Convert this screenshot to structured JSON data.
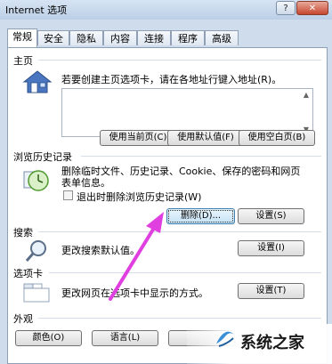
{
  "window": {
    "title": "Internet 选项",
    "help_label": "?",
    "close_label": "✕"
  },
  "tabs": [
    "常规",
    "安全",
    "隐私",
    "内容",
    "连接",
    "程序",
    "高级"
  ],
  "home": {
    "section": "主页",
    "description": "若要创建主页选项卡，请在各地址行键入地址(R)。",
    "buttons": [
      "使用当前页(C)",
      "使用默认值(F)",
      "使用空白页(B)"
    ]
  },
  "history": {
    "section": "浏览历史记录",
    "description_line1": "删除临时文件、历史记录、Cookie、保存的密码和网页",
    "description_line2": "表单信息。",
    "checkbox_label": "退出时删除浏览历史记录(W)",
    "delete_button": "删除(D)...",
    "settings_button": "设置(S)"
  },
  "search": {
    "section": "搜索",
    "description": "更改搜索默认值。",
    "settings_button": "设置(I)"
  },
  "tabs_section": {
    "section": "选项卡",
    "description": "更改网页在选项卡中显示的方式。",
    "settings_button": "设置(T)"
  },
  "appearance": {
    "section": "外观",
    "buttons": [
      "颜色(O)",
      "语言(L)"
    ]
  },
  "watermark": {
    "text": "系统之家"
  },
  "colors": {
    "annotation_arrow": "#e040e0",
    "accent": "#3c7fb1"
  },
  "icons": {
    "home": "house-icon",
    "history": "clock-icon",
    "search": "magnifier-icon",
    "tabs": "tabs-icon"
  }
}
